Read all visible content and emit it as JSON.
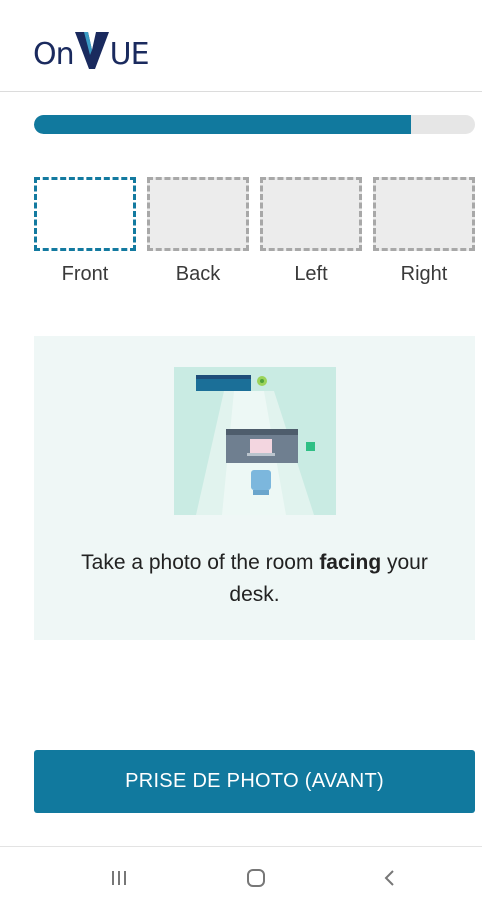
{
  "header": {
    "logo_text_left": "On",
    "logo_text_right": "UE",
    "logo_color": "#1a2a5e"
  },
  "progress": {
    "value_percent": 85.5,
    "fill_color": "#11799e",
    "track_color": "#e6e6e6"
  },
  "photo_slots": [
    {
      "label": "Front",
      "active": true
    },
    {
      "label": "Back",
      "active": false
    },
    {
      "label": "Left",
      "active": false
    },
    {
      "label": "Right",
      "active": false
    }
  ],
  "instruction": {
    "text_before": "Take a photo of the room ",
    "text_bold": "facing",
    "text_after": " your desk.",
    "illustration_icon": "room-desk-camera-illustration"
  },
  "action": {
    "label": "PRISE DE PHOTO (AVANT)",
    "color": "#11799e"
  },
  "navbar": {
    "recent_icon": "recent-apps-icon",
    "home_icon": "home-icon",
    "back_icon": "back-icon"
  }
}
